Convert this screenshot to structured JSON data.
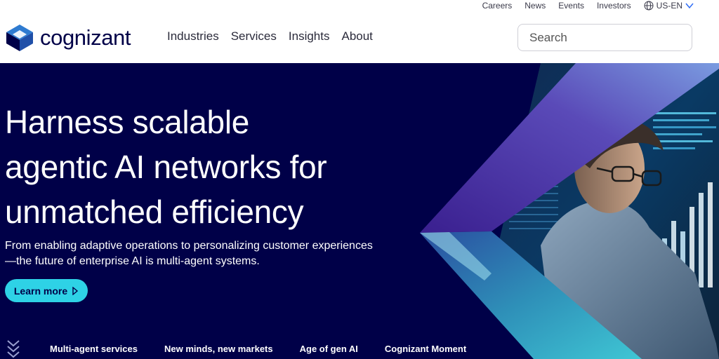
{
  "header": {
    "brand": "cognizant",
    "utility_links": [
      "Careers",
      "News",
      "Events",
      "Investors"
    ],
    "locale": "US-EN",
    "nav": [
      "Industries",
      "Services",
      "Insights",
      "About"
    ],
    "search": {
      "placeholder": "Search"
    }
  },
  "hero": {
    "headline_lines": [
      "Harness scalable",
      "agentic AI networks for",
      "unmatched efficiency"
    ],
    "subtext_lines": [
      "From enabling adaptive operations to personalizing customer experiences",
      "—the future of enterprise AI is multi-agent systems."
    ],
    "cta_label": "Learn more",
    "tabs": [
      "Multi-agent services",
      "New minds, new markets",
      "Age of gen AI",
      "Cognizant Moment"
    ],
    "active_tab": 0
  },
  "colors": {
    "brand_navy": "#000048",
    "accent_cyan": "#2ed2e6",
    "accent_blue": "#2f6df6"
  },
  "icons": [
    "globe-icon",
    "chevron-down-icon",
    "search-icon",
    "play-arrow-icon",
    "scroll-down-icon"
  ]
}
